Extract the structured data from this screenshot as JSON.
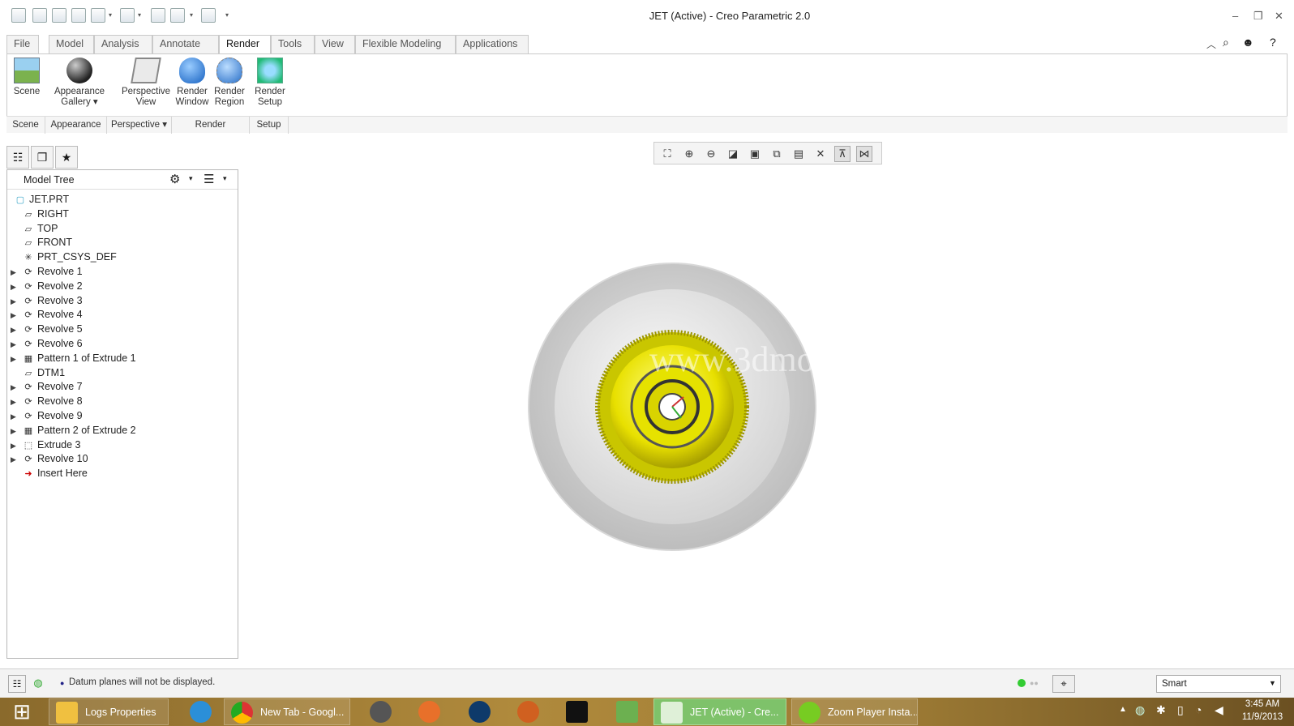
{
  "window": {
    "title": "JET (Active) - Creo Parametric 2.0",
    "minimize": "–",
    "restore": "❐",
    "close": "✕"
  },
  "ribbon_tabs": [
    "File ▾",
    "Model",
    "Analysis",
    "Annotate",
    "Render",
    "Tools",
    "View",
    "Flexible Modeling",
    "Applications"
  ],
  "active_tab": "Render",
  "ribbon_buttons": {
    "scene": "Scene",
    "appearance_gallery": "Appearance Gallery ▾",
    "perspective_view": "Perspective View",
    "render_window": "Render Window",
    "render_region": "Render Region",
    "render_setup": "Render Setup"
  },
  "ribbon_groups": [
    "Scene",
    "Appearance",
    "Perspective ▾",
    "Render",
    "Setup"
  ],
  "navigator": {
    "title": "Model Tree"
  },
  "model_tree": [
    {
      "label": "JET.PRT",
      "icon": "part-icon",
      "expandable": false,
      "root": true
    },
    {
      "label": "RIGHT",
      "icon": "datum-plane-icon",
      "expandable": false
    },
    {
      "label": "TOP",
      "icon": "datum-plane-icon",
      "expandable": false
    },
    {
      "label": "FRONT",
      "icon": "datum-plane-icon",
      "expandable": false
    },
    {
      "label": "PRT_CSYS_DEF",
      "icon": "csys-icon",
      "expandable": false
    },
    {
      "label": "Revolve 1",
      "icon": "revolve-icon",
      "expandable": true
    },
    {
      "label": "Revolve 2",
      "icon": "revolve-icon",
      "expandable": true
    },
    {
      "label": "Revolve 3",
      "icon": "revolve-icon",
      "expandable": true
    },
    {
      "label": "Revolve 4",
      "icon": "revolve-icon",
      "expandable": true
    },
    {
      "label": "Revolve 5",
      "icon": "revolve-icon",
      "expandable": true
    },
    {
      "label": "Revolve 6",
      "icon": "revolve-icon",
      "expandable": true
    },
    {
      "label": "Pattern 1 of Extrude 1",
      "icon": "pattern-icon",
      "expandable": true
    },
    {
      "label": "DTM1",
      "icon": "datum-plane-icon",
      "expandable": false
    },
    {
      "label": "Revolve 7",
      "icon": "revolve-icon",
      "expandable": true
    },
    {
      "label": "Revolve 8",
      "icon": "revolve-icon",
      "expandable": true
    },
    {
      "label": "Revolve 9",
      "icon": "revolve-icon",
      "expandable": true
    },
    {
      "label": "Pattern 2 of Extrude 2",
      "icon": "pattern-icon",
      "expandable": true
    },
    {
      "label": "Extrude 3",
      "icon": "extrude-icon",
      "expandable": true
    },
    {
      "label": "Revolve 10",
      "icon": "revolve-icon",
      "expandable": true
    },
    {
      "label": "Insert Here",
      "icon": "insert-here-icon",
      "expandable": false
    }
  ],
  "watermark": "www.3dmox.com",
  "status": {
    "message": "Datum planes will not be displayed.",
    "filter": "Smart"
  },
  "taskbar": {
    "items": [
      "Logs Properties",
      "New Tab - Googl...",
      "JET (Active) - Cre...",
      "Zoom Player Insta..."
    ],
    "time": "3:45 AM",
    "date": "11/9/2013"
  }
}
